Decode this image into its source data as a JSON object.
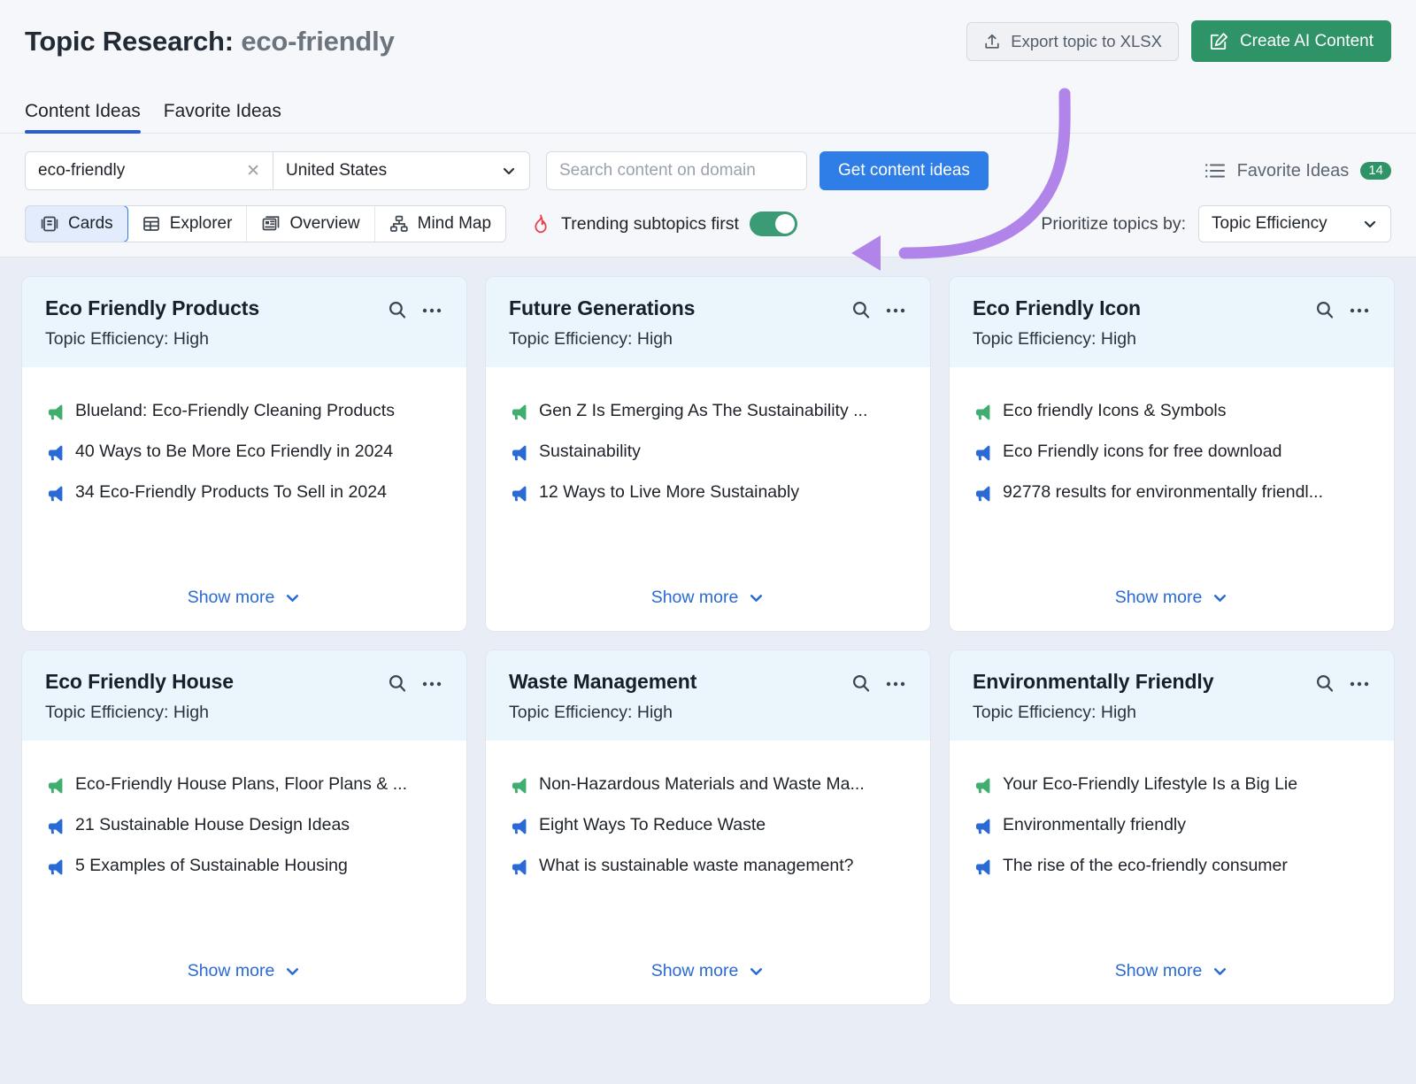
{
  "header": {
    "title_prefix": "Topic Research:",
    "title_keyword": "eco-friendly",
    "export_label": "Export topic to XLSX",
    "create_ai_label": "Create AI Content"
  },
  "tabs": [
    {
      "label": "Content Ideas",
      "active": true
    },
    {
      "label": "Favorite Ideas",
      "active": false
    }
  ],
  "toolbar": {
    "keyword_value": "eco-friendly",
    "keyword_clear": "✕",
    "country_value": "United States",
    "domain_placeholder": "Search content on domain",
    "get_ideas_label": "Get content ideas",
    "favorite_ideas_label": "Favorite Ideas",
    "favorite_ideas_count": "14",
    "views": [
      {
        "label": "Cards",
        "icon": "cards-icon",
        "active": true
      },
      {
        "label": "Explorer",
        "icon": "table-icon",
        "active": false
      },
      {
        "label": "Overview",
        "icon": "overview-icon",
        "active": false
      },
      {
        "label": "Mind Map",
        "icon": "mindmap-icon",
        "active": false
      }
    ],
    "trending_label": "Trending subtopics first",
    "trending_enabled": true,
    "prioritize_label": "Prioritize topics by:",
    "prioritize_value": "Topic Efficiency"
  },
  "cards": [
    {
      "title": "Eco Friendly Products",
      "efficiency": "Topic Efficiency: High",
      "show_more": "Show more",
      "ideas": [
        {
          "text": "Blueland: Eco-Friendly Cleaning Products",
          "color": "green"
        },
        {
          "text": "40 Ways to Be More Eco Friendly in 2024",
          "color": "blue"
        },
        {
          "text": "34 Eco-Friendly Products To Sell in 2024",
          "color": "blue"
        }
      ]
    },
    {
      "title": "Future Generations",
      "efficiency": "Topic Efficiency: High",
      "show_more": "Show more",
      "ideas": [
        {
          "text": "Gen Z Is Emerging As The Sustainability ...",
          "color": "green"
        },
        {
          "text": "Sustainability",
          "color": "blue"
        },
        {
          "text": "12 Ways to Live More Sustainably",
          "color": "blue"
        }
      ]
    },
    {
      "title": "Eco Friendly Icon",
      "efficiency": "Topic Efficiency: High",
      "show_more": "Show more",
      "ideas": [
        {
          "text": "Eco friendly Icons & Symbols",
          "color": "green"
        },
        {
          "text": "Eco Friendly icons for free download",
          "color": "blue"
        },
        {
          "text": "92778 results for environmentally friendl...",
          "color": "blue"
        }
      ]
    },
    {
      "title": "Eco Friendly House",
      "efficiency": "Topic Efficiency: High",
      "show_more": "Show more",
      "ideas": [
        {
          "text": "Eco-Friendly House Plans, Floor Plans & ...",
          "color": "green"
        },
        {
          "text": "21 Sustainable House Design Ideas",
          "color": "blue"
        },
        {
          "text": "5 Examples of Sustainable Housing",
          "color": "blue"
        }
      ]
    },
    {
      "title": "Waste Management",
      "efficiency": "Topic Efficiency: High",
      "show_more": "Show more",
      "ideas": [
        {
          "text": "Non-Hazardous Materials and Waste Ma...",
          "color": "green"
        },
        {
          "text": "Eight Ways To Reduce Waste",
          "color": "blue"
        },
        {
          "text": "What is sustainable waste management?",
          "color": "blue"
        }
      ]
    },
    {
      "title": "Environmentally Friendly",
      "efficiency": "Topic Efficiency: High",
      "show_more": "Show more",
      "ideas": [
        {
          "text": "Your Eco-Friendly Lifestyle Is a Big Lie",
          "color": "green"
        },
        {
          "text": "Environmentally friendly",
          "color": "blue"
        },
        {
          "text": "The rise of the eco-friendly consumer",
          "color": "blue"
        }
      ]
    }
  ],
  "colors": {
    "accent_blue": "#2f7ee8",
    "accent_green": "#2e9467",
    "toggle_on": "#3a9b74",
    "annotation_purple": "#b184ea",
    "card_header_blue": "#eaf5fc",
    "content_bg": "#e9edf6",
    "idea_green": "#3fae6f",
    "idea_blue": "#2a6ad4"
  }
}
